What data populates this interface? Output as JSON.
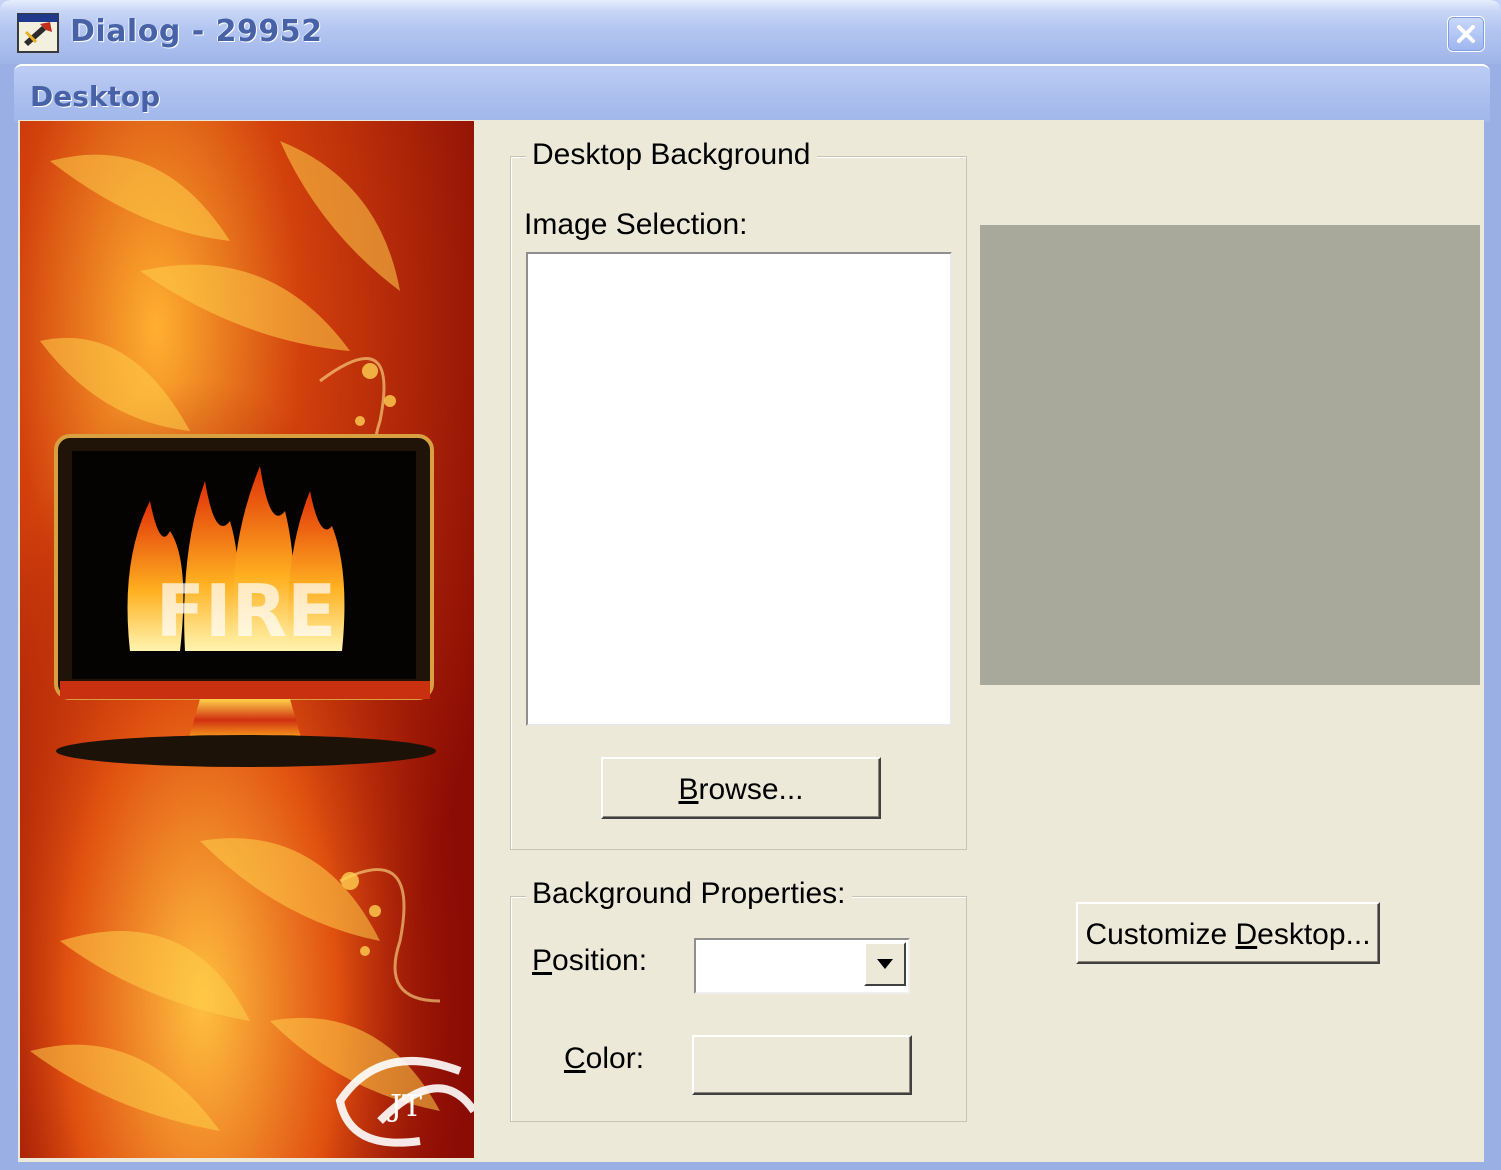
{
  "window": {
    "title": "Dialog - 29952",
    "icon": "app-wrench-icon",
    "close_icon": "close-icon"
  },
  "tab": {
    "label": "Desktop"
  },
  "desktop_background": {
    "group_title": "Desktop Background",
    "image_selection_label": "Image Selection:",
    "browse_button": {
      "pre": "",
      "accel": "B",
      "post": "rowse..."
    }
  },
  "background_properties": {
    "group_title": "Background Properties:",
    "position_label": {
      "accel": "P",
      "post": "osition:"
    },
    "position_value": "",
    "color_label": {
      "accel": "C",
      "post": "olor:"
    }
  },
  "customize_button": {
    "pre": "Customize ",
    "accel": "D",
    "post": "esktop..."
  },
  "banner": {
    "text": "FIRE",
    "monogram": "JT"
  },
  "colors": {
    "client_bg": "#ece9d8",
    "preview_bg": "#a8a99b",
    "title_text": "#4862a8"
  }
}
